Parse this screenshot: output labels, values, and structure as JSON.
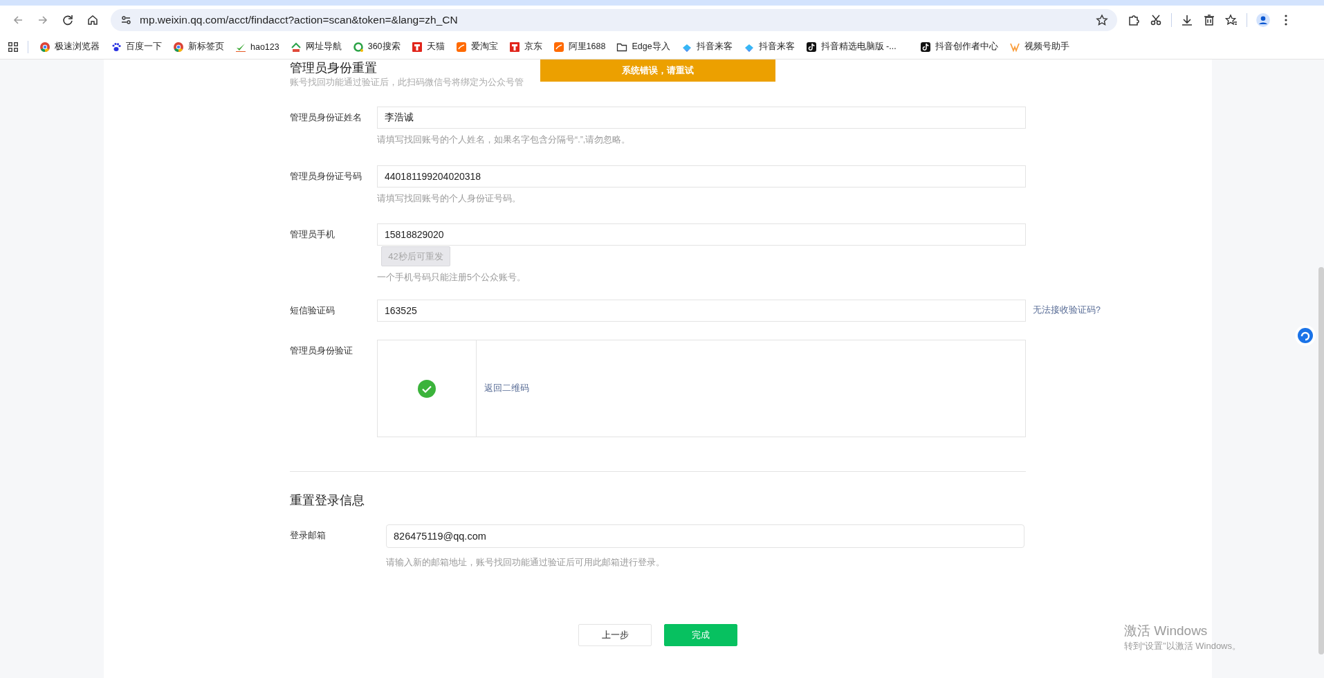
{
  "browser": {
    "url": "mp.weixin.qq.com/acct/findacct?action=scan&token=&lang=zh_CN"
  },
  "bookmarks": [
    {
      "label": "极速浏览器"
    },
    {
      "label": "百度一下"
    },
    {
      "label": "新标签页"
    },
    {
      "label": "hao123"
    },
    {
      "label": "网址导航"
    },
    {
      "label": "360搜索"
    },
    {
      "label": "天猫"
    },
    {
      "label": "爱淘宝"
    },
    {
      "label": "京东"
    },
    {
      "label": "阿里1688"
    },
    {
      "label": "Edge导入"
    },
    {
      "label": "抖音来客"
    },
    {
      "label": "抖音来客"
    },
    {
      "label": "抖音精选电脑版 -..."
    },
    {
      "label": "抖音创作者中心"
    },
    {
      "label": "视频号助手"
    }
  ],
  "toast": "系统错误，请重试",
  "section1": {
    "title": "管理员身份重置",
    "subtitle": "账号找回功能通过验证后，此扫码微信号将绑定为公众号管"
  },
  "fields": [
    {
      "kind": "input",
      "label": "管理员身份证姓名",
      "value": "李浩诚",
      "hint": "请填写找回账号的个人姓名，如果名字包含分隔号“.”,请勿忽略。"
    },
    {
      "kind": "input",
      "label": "管理员身份证号码",
      "value": "440181199204020318",
      "hint": "请填写找回账号的个人身份证号码。"
    },
    {
      "kind": "phone",
      "label": "管理员手机",
      "value": "15818829020",
      "resend": {
        "label": "42秒后可重发",
        "disabled": true
      },
      "hint": "一个手机号码只能注册5个公众账号。"
    },
    {
      "kind": "input",
      "label": "短信验证码",
      "value": "163525",
      "link": "无法接收验证码?"
    },
    {
      "kind": "verify",
      "label": "管理员身份验证",
      "verified": true,
      "link": "返回二维码"
    }
  ],
  "section2": {
    "title": "重置登录信息",
    "label": "登录邮箱",
    "value": "826475119@qq.com",
    "hint": "请输入新的邮箱地址，账号找回功能通过验证后可用此邮箱进行登录。"
  },
  "buttons": [
    {
      "label": "上一步",
      "kind": "secondary"
    },
    {
      "label": "完成",
      "kind": "primary"
    }
  ],
  "os_notice": {
    "title": "激活 Windows",
    "subtitle": "转到“设置”以激活 Windows。"
  }
}
